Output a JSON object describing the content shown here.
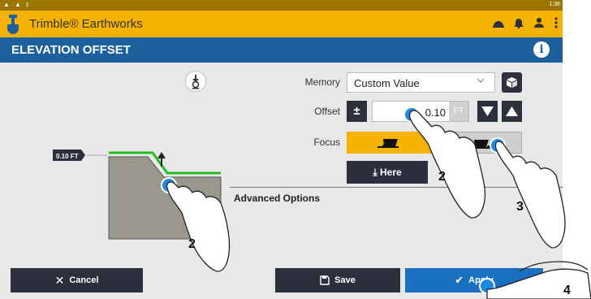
{
  "status_bar": {
    "left_icons": "▲ ▲ ⫾",
    "time": "1:36"
  },
  "app_bar": {
    "title": "Trimble® Earthworks",
    "icons": [
      "hardhat-icon",
      "bell-icon",
      "user-icon",
      "more-vert-icon"
    ]
  },
  "title_bar": {
    "title": "ELEVATION OFFSET",
    "info_icon": "i"
  },
  "form": {
    "memory_label": "Memory",
    "memory_value": "Custom Value",
    "offset_label": "Offset",
    "offset_sign": "±",
    "offset_value": "0.10",
    "offset_unit": "FT",
    "focus_label": "Focus",
    "here_label": "Here"
  },
  "advanced_options": "Advanced Options",
  "diagram": {
    "offset_tag": "0.10 FT"
  },
  "footer": {
    "cancel": "Cancel",
    "save": "Save",
    "apply": "Apply"
  },
  "annotations": {
    "n1": "2",
    "n2": "3",
    "n3": "2",
    "n4": "4"
  },
  "colors": {
    "accent_yellow": "#f5b300",
    "title_blue": "#1b5f9c",
    "apply_blue": "#1b6fc0",
    "dark_button": "#2c2f3c",
    "green_line": "#22c022"
  }
}
